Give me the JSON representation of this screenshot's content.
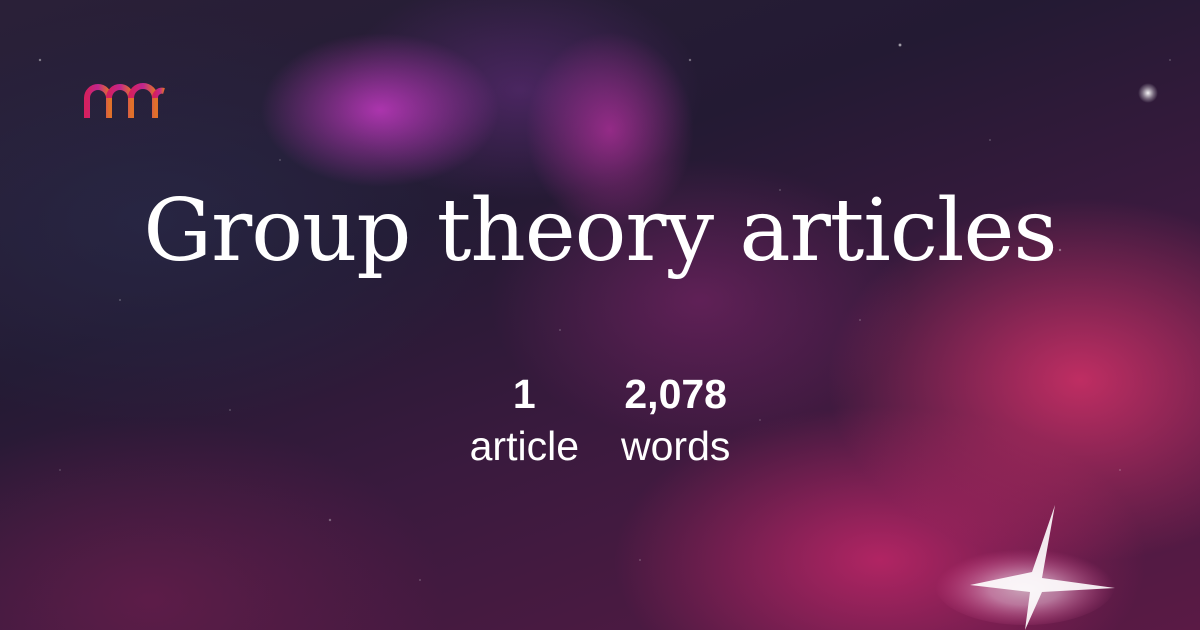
{
  "page": {
    "title": "Group theory articles"
  },
  "logo": {
    "icon": "brand-arches-icon",
    "colors": [
      "#d4205f",
      "#c0268f",
      "#e0702a"
    ]
  },
  "stats": [
    {
      "value": "1",
      "label": "article"
    },
    {
      "value": "2,078",
      "label": "words"
    }
  ]
}
